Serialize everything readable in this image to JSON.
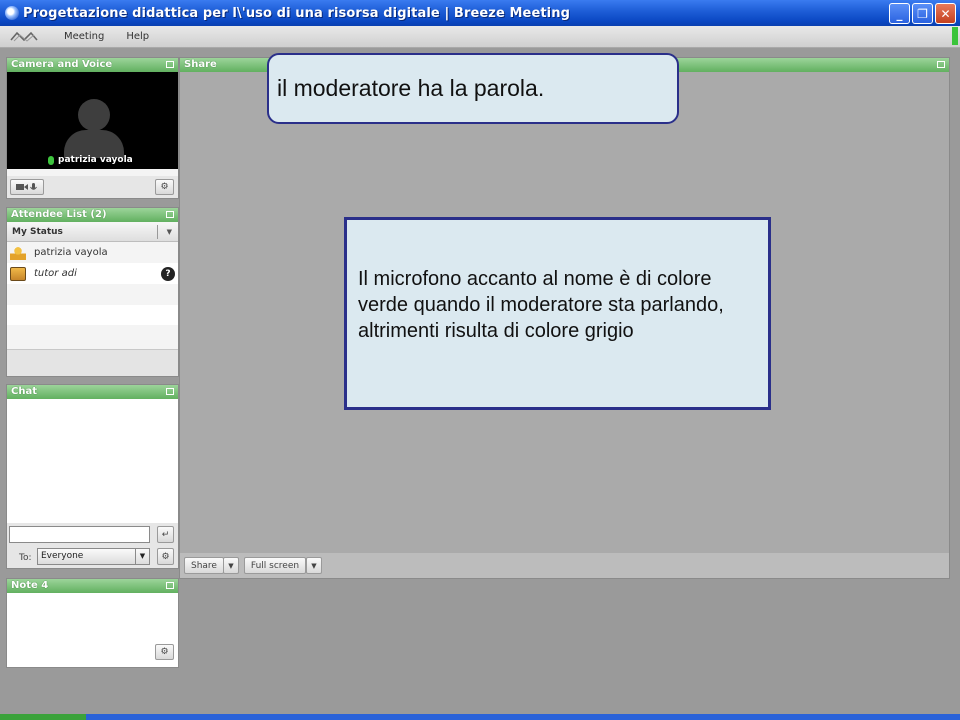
{
  "window": {
    "title": "Progettazione didattica per l\\'uso di una risorsa digitale | Breeze Meeting",
    "minimize_glyph": "_",
    "maximize_glyph": "❐",
    "close_glyph": "✕"
  },
  "menu": {
    "items": [
      "Meeting",
      "Help"
    ]
  },
  "camera_pod": {
    "title": "Camera and Voice",
    "participant_name": "patrizia vayola",
    "mic_status_color": "#3ec43e"
  },
  "attendee_pod": {
    "title": "Attendee List (2)",
    "my_status_label": "My Status",
    "attendees": [
      {
        "name": "patrizia vayola",
        "role_icon": "presenter-icon"
      },
      {
        "name": "tutor adi",
        "role_icon": "participant-icon",
        "status_badge": "?"
      }
    ]
  },
  "chat_pod": {
    "title": "Chat",
    "to_label": "To:",
    "to_value": "Everyone"
  },
  "share_pod": {
    "title": "Share",
    "share_button": "Share",
    "fullscreen_button": "Full screen"
  },
  "note_pod": {
    "title": "Note 4"
  },
  "callouts": {
    "top": "il moderatore ha la parola.",
    "main": "Il microfono accanto al nome è di colore verde quando il moderatore sta parlando, altrimenti risulta di colore grigio"
  },
  "colors": {
    "pod_header": "#62b060",
    "callout_border": "#2a2f8a",
    "callout_bg": "#dbe9f0"
  }
}
